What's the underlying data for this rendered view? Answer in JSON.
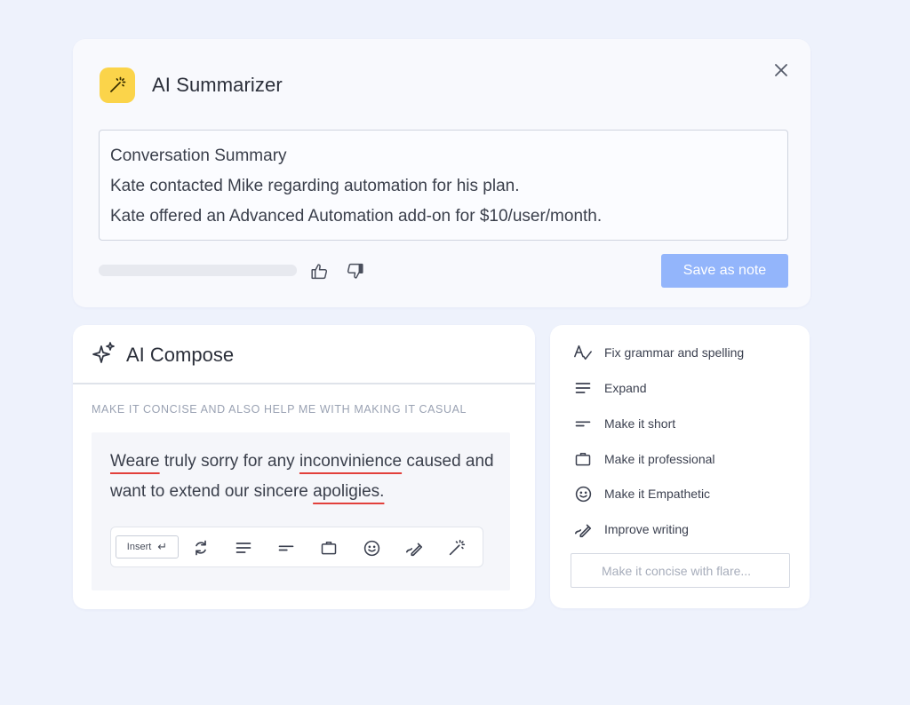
{
  "summarizer": {
    "title": "AI Summarizer",
    "summary_lines": [
      "Conversation Summary",
      "Kate contacted Mike regarding automation for his plan.",
      "Kate offered an Advanced Automation add-on for $10/user/month."
    ],
    "save_label": "Save as note",
    "colors": {
      "logo_bg": "#fbd44a",
      "save_button": "#93b5fb"
    }
  },
  "compose": {
    "title": "AI Compose",
    "prompt": "MAKE IT CONCISE AND ALSO HELP ME WITH MAKING IT CASUAL",
    "draft": {
      "w1": "Weare",
      "t1": " truly sorry for any ",
      "w2": "inconvinience",
      "t2": " caused and want to extend our sincere ",
      "w3": "apoligies."
    },
    "insert_label": "Insert",
    "toolbar_icons": [
      "rephrase-icon",
      "expand-icon",
      "shorten-icon",
      "professional-icon",
      "empathetic-icon",
      "improve-writing-icon",
      "magic-wand-icon"
    ]
  },
  "options": {
    "items": [
      {
        "label": "Fix grammar and spelling",
        "icon": "grammar-icon"
      },
      {
        "label": "Expand",
        "icon": "expand-icon"
      },
      {
        "label": "Make it short",
        "icon": "shorten-icon"
      },
      {
        "label": "Make it professional",
        "icon": "briefcase-icon"
      },
      {
        "label": "Make it Empathetic",
        "icon": "smiley-icon"
      },
      {
        "label": "Improve writing",
        "icon": "improve-writing-icon"
      }
    ],
    "custom_placeholder": "Make it concise with flare..."
  }
}
